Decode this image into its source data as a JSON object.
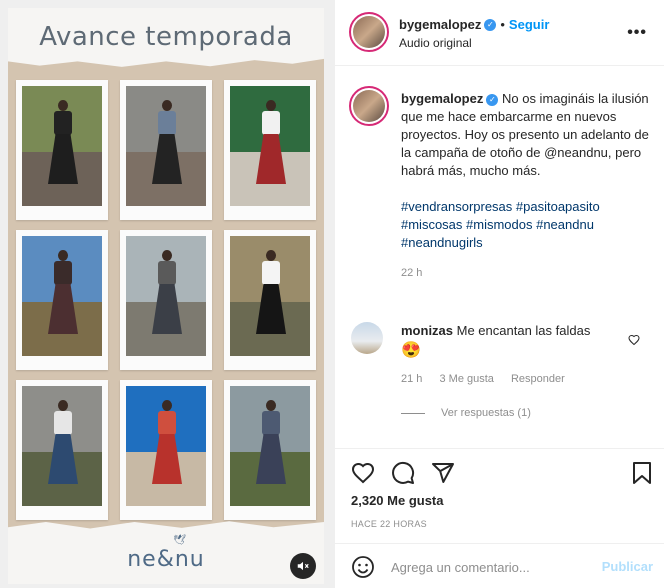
{
  "media": {
    "title": "Avance temporada",
    "brand": "ne&nu",
    "mute_icon": "speaker-muted-icon",
    "cards": [
      {
        "sky": "#7a8a55",
        "ground": "#6d6258",
        "top": "#222222",
        "skirt": "#1e1e1e"
      },
      {
        "sky": "#8a8a86",
        "ground": "#7d7065",
        "top": "#6b7f99",
        "skirt": "#232323"
      },
      {
        "sky": "#2f6b3f",
        "ground": "#c9c3b8",
        "top": "#f1f1f1",
        "skirt": "#a0282a"
      },
      {
        "sky": "#5b8cc0",
        "ground": "#7c6d4a",
        "top": "#3a2b2a",
        "skirt": "#4c2f31"
      },
      {
        "sky": "#aab4b8",
        "ground": "#7d7a70",
        "top": "#5a5a5a",
        "skirt": "#3b3f47"
      },
      {
        "sky": "#9a8c6a",
        "ground": "#6b6a52",
        "top": "#f4f4f4",
        "skirt": "#151515"
      },
      {
        "sky": "#8e8e8a",
        "ground": "#5c6347",
        "top": "#e6e6e6",
        "skirt": "#2d4a70"
      },
      {
        "sky": "#1f6fbf",
        "ground": "#c7b9a5",
        "top": "#cf4f3e",
        "skirt": "#b8322c"
      },
      {
        "sky": "#8c9aa0",
        "ground": "#5a6a40",
        "top": "#4d5a72",
        "skirt": "#3a4158"
      }
    ]
  },
  "header": {
    "username": "bygemalopez",
    "follow_label": "Seguir",
    "audio_label": "Audio original"
  },
  "caption": {
    "username": "bygemalopez",
    "text": "No os imagináis la ilusión que me hace embarcarme en nuevos proyectos. Hoy os presento un adelanto de la campaña de otoño de @neandnu, pero habrá más, mucho más.",
    "hashtags_line1": "#vendransorpresas #pasitoapasito",
    "hashtags_line2": "#miscosas #mismodos #neandnu",
    "hashtags_line3": "#neandnugirls",
    "time": "22 h"
  },
  "comment": {
    "username": "monizas",
    "text": "Me encantan las faldas",
    "emoji": "😍",
    "time": "21 h",
    "likes": "3 Me gusta",
    "reply_label": "Responder",
    "view_replies": "Ver respuestas (1)"
  },
  "actions": {
    "likes": "2,320 Me gusta",
    "posted": "HACE 22 HORAS"
  },
  "composer": {
    "placeholder": "Agrega un comentario...",
    "publish_label": "Publicar"
  }
}
